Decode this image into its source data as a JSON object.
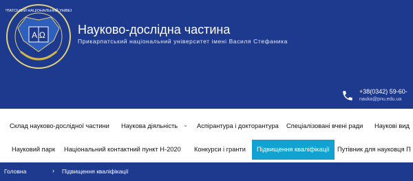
{
  "header": {
    "title": "Науково-дослідна частина",
    "subtitle": "Прикарпатський національний університет імені Василя Стефаника",
    "logo_label": "ПРИКАРПАТСЬКИЙ НАЦІОНАЛЬНИЙ УНІВЕРСИТЕТ",
    "logo_letters": "A Ω",
    "phone": "+38(0342) 59-60-",
    "email": "nauka@pnu.edu.ua",
    "icons": {
      "phone": "phone-icon",
      "logo": "university-logo"
    },
    "colors": {
      "header_bg": "#1e3a8f",
      "active_bg": "#12a2d1"
    }
  },
  "menu": {
    "primary": [
      {
        "label": "Склад науково-дослідної частини"
      },
      {
        "label": "Наукова діяльність"
      },
      {
        "label": "Аспірантура і докторантура"
      },
      {
        "label": "Спеціалізовані вчені ради"
      },
      {
        "label": "Наукові вид"
      }
    ],
    "secondary": [
      {
        "label": "Науковий парк"
      },
      {
        "label": "Національний контактний пункт Н-2020"
      },
      {
        "label": "Конкурси і гранти"
      },
      {
        "label": "Підвищення кваліфікації"
      },
      {
        "label": "Путівник для науковця П"
      }
    ]
  },
  "breadcrumb": {
    "home": "Головна",
    "separator": "›",
    "current": "Підвищення кваліфікації"
  }
}
